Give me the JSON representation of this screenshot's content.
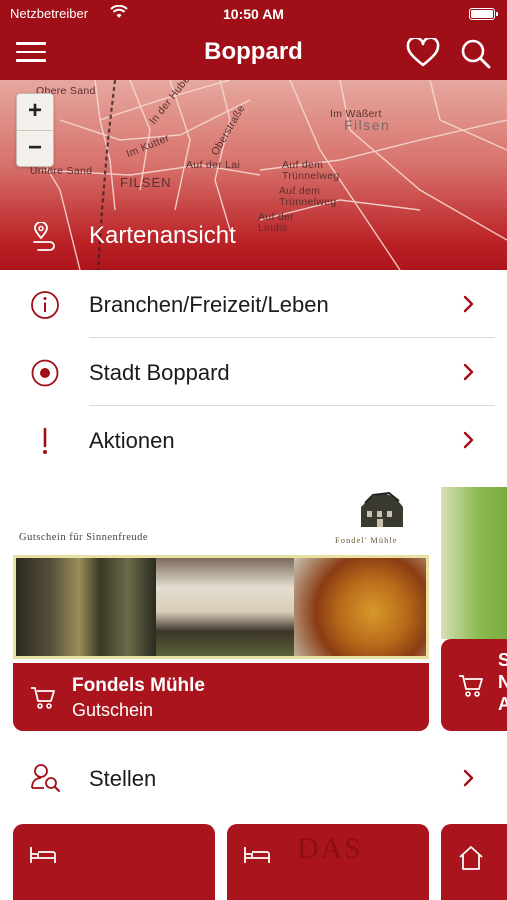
{
  "status_bar": {
    "carrier": "Netzbetreiber",
    "time": "10:50 AM"
  },
  "nav": {
    "title": "Boppard",
    "menu_icon": "hamburger-menu-icon",
    "favorites_icon": "heart-icon",
    "search_icon": "search-icon"
  },
  "map": {
    "zoom_in": "+",
    "zoom_out": "−",
    "place_labels": {
      "obere_sand": "Obere Sand",
      "in_der_hube": "In der Hube",
      "im_kutter": "Im Kutter",
      "oberstrasse": "Oberstraße",
      "auf_der_lai": "Auf der Lai",
      "untere_sand": "Untere Sand",
      "filsen": "FILSEN",
      "im_wasert": "Im Wäßert",
      "filsen_big": "Filsen",
      "auf_dem_trunnelweg_1": "Auf dem Trünnelweg",
      "auf_dem_trunnelweg_2": "Auf dem Trünnelweg",
      "auf_der_lindis": "Auf der Lindis"
    },
    "label": "Kartenansicht",
    "icon": "map-pin-icon"
  },
  "menu_items": [
    {
      "label": "Branchen/Freizeit/Leben",
      "icon": "info-circle-icon"
    },
    {
      "label": "Stadt Boppard",
      "icon": "target-circle-icon"
    },
    {
      "label": "Aktionen",
      "icon": "exclamation-icon"
    }
  ],
  "vouchers": [
    {
      "banner_text": "Gutschein für Sinnenfreude",
      "logo_text": "Fondel' Mühle",
      "title": "Fondels Mühle",
      "subtitle": "Gutschein",
      "icon": "cart-icon"
    },
    {
      "title_partial": "S\nN\nA",
      "icon": "cart-icon"
    }
  ],
  "stellen": {
    "label": "Stellen",
    "icon": "person-search-icon"
  },
  "tiles": [
    {
      "icon": "bed-icon"
    },
    {
      "icon": "bed-icon",
      "ghost_text": "DAS"
    },
    {
      "icon": "home-icon"
    }
  ],
  "colors": {
    "brand_red": "#a00f18",
    "card_red": "#a9141d",
    "chevron": "#a00f18"
  }
}
